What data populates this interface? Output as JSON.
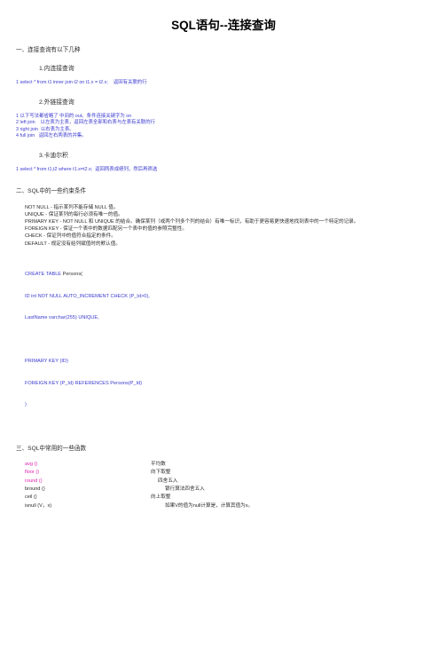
{
  "document": {
    "title": "SQL语句--连接查询"
  },
  "sections": [
    {
      "heading": "一、连接查询有以下几种",
      "subsections": [
        {
          "heading": "1.内连接查询",
          "code": [
            {
              "num": "1",
              "text": "select * from t1 inner join t2 on t1.x = t2.x;    返回有关联的行"
            }
          ]
        },
        {
          "heading": "2.外链接查询",
          "code": [
            {
              "num": "1",
              "text": "以下写法都省略了 中间的 out。条件连接关键字为 on"
            },
            {
              "num": "2",
              "text": "left join    以左表为主表，返回左表全部和右表与左表有关联的行"
            },
            {
              "num": "3",
              "text": "right join  以右表为主表。"
            },
            {
              "num": "4",
              "text": "full join   返回左右两表的并集。"
            }
          ]
        },
        {
          "heading": "3.卡迪尔积",
          "code": [
            {
              "num": "1",
              "text": "select * from t1,t2 where t1.x=t2.x;  返回两表成绩列，然后再筛选"
            }
          ]
        }
      ]
    },
    {
      "heading": "二、SQL中的一些约束条件",
      "constraints": [
        "NOT NULL - 指示某列不能存储 NULL 值。",
        "UNIQUE - 保证某列的每行必须有唯一的值。",
        "PRIMARY KEY - NOT NULL 和 UNIQUE 的结合。确保某列（或两个列多个列的结合）有唯一标识，有助于更容易更快速地找到表中的一个特定的记录。",
        "FOREIGN KEY - 保证一个表中的数据匹配另一个表中的值的参照完整性。",
        "CHECK - 保证列中的值符合指定的条件。",
        "DEFAULT - 规定没有给列赋值时的默认值。"
      ],
      "create_table": {
        "line1_kw": "CREATE TABLE ",
        "line1_name": "Persons(",
        "line2": "ID int NOT NULL AUTO_INCREMENT CHECK (P_Id>0),",
        "line3": "LastName varchar(255) UNIQUE,",
        "line4": "",
        "line5": "PRIMARY KEY (ID)",
        "line6": "FOREIGN KEY (P_Id) REFERENCES Persons(P_Id)",
        "line7": ")"
      }
    },
    {
      "heading": "三、SQL中常用的一些函数",
      "functions": [
        {
          "name": "avg  ()",
          "desc": "平均数",
          "indent": 0,
          "highlight": true
        },
        {
          "name": "floor  ()",
          "desc": "向下取整",
          "indent": 0,
          "highlight": true
        },
        {
          "name": "round  ()",
          "desc": "四舍五入",
          "indent": 1,
          "highlight": true
        },
        {
          "name": "bround  ()",
          "desc": "银行算法四舍五入",
          "indent": 2,
          "highlight": false
        },
        {
          "name": "ceil  ()",
          "desc": "向上取整",
          "indent": 0,
          "highlight": false
        },
        {
          "name": "isnull  (V，x)",
          "desc": "如果V的值为null计算是，计算其值为x。",
          "indent": 2,
          "highlight": false
        }
      ]
    }
  ]
}
